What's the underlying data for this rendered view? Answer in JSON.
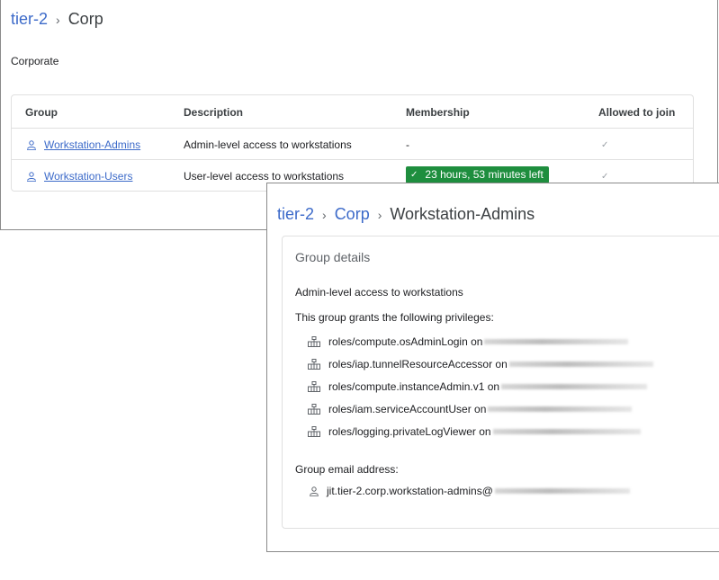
{
  "back_window": {
    "breadcrumb": {
      "root": "tier-2",
      "current": "Corp"
    },
    "subtitle": "Corporate",
    "table": {
      "headers": [
        "Group",
        "Description",
        "Membership",
        "Allowed to join"
      ],
      "rows": [
        {
          "group": "Workstation-Admins",
          "description": "Admin-level access to workstations",
          "membership": "-",
          "allowed": "✓"
        },
        {
          "group": "Workstation-Users",
          "description": "User-level access to workstations",
          "membership": "23 hours, 53 minutes left",
          "allowed": "✓"
        }
      ]
    },
    "colors": {
      "link": "#3c6ac9",
      "badge_bg": "#1e8e3e"
    }
  },
  "front_window": {
    "breadcrumb": {
      "root": "tier-2",
      "middle": "Corp",
      "current": "Workstation-Admins"
    },
    "card_title": "Group details",
    "description": "Admin-level access to workstations",
    "grants_label": "This group grants the following privileges:",
    "privileges": [
      "roles/compute.osAdminLogin on",
      "roles/iap.tunnelResourceAccessor on",
      "roles/compute.instanceAdmin.v1 on",
      "roles/iam.serviceAccountUser on",
      "roles/logging.privateLogViewer on"
    ],
    "email_label": "Group email address:",
    "email": "jit.tier-2.corp.workstation-admins@"
  },
  "icons": {
    "group": "group-icon",
    "privilege": "privilege-icon",
    "check": "check-icon"
  }
}
